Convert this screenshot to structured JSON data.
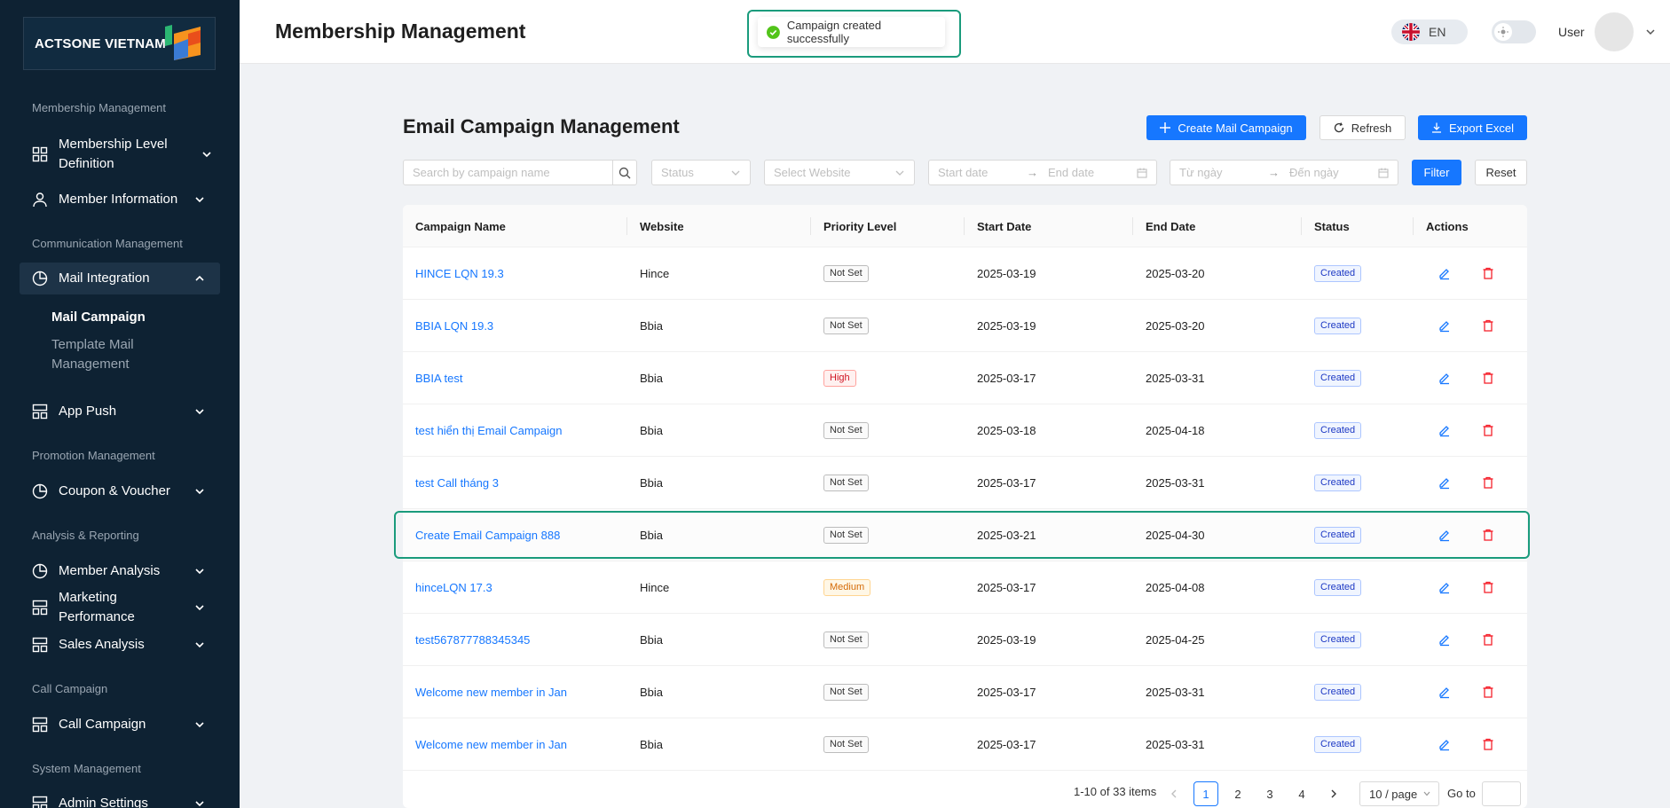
{
  "sidebar": {
    "logo_text": "ACTSONE VIETNAM",
    "sections": {
      "membership": "Membership Management",
      "communication": "Communication Management",
      "promotion": "Promotion Management",
      "analysis": "Analysis & Reporting",
      "call": "Call Campaign",
      "system": "System Management"
    },
    "items": {
      "membership_level": "Membership Level Definition",
      "member_info": "Member Information",
      "mail_integration": "Mail Integration",
      "mail_campaign": "Mail Campaign",
      "template_mail": "Template Mail Management",
      "app_push": "App Push",
      "coupon": "Coupon & Voucher",
      "member_analysis": "Member Analysis",
      "marketing_perf": "Marketing Performance",
      "sales_analysis": "Sales Analysis",
      "call_campaign": "Call Campaign",
      "admin_settings": "Admin Settings"
    }
  },
  "header": {
    "title": "Membership Management",
    "toast": "Campaign created successfully",
    "lang": "EN",
    "user": "User"
  },
  "main": {
    "title": "Email Campaign Management",
    "buttons": {
      "create": "Create Mail Campaign",
      "refresh": "Refresh",
      "export": "Export Excel",
      "filter": "Filter",
      "reset": "Reset"
    },
    "filters": {
      "search_placeholder": "Search by campaign name",
      "status_placeholder": "Status",
      "website_placeholder": "Select Website",
      "start_date": "Start date",
      "end_date": "End date",
      "from_date": "Từ ngày",
      "to_date": "Đến ngày",
      "arrow": "→"
    },
    "table": {
      "columns": [
        "Campaign Name",
        "Website",
        "Priority Level",
        "Start Date",
        "End Date",
        "Status",
        "Actions"
      ],
      "rows": [
        {
          "name": "HINCE LQN 19.3",
          "website": "Hince",
          "priority": "Not Set",
          "start": "2025-03-19",
          "end": "2025-03-20",
          "status": "Created"
        },
        {
          "name": "BBIA LQN 19.3",
          "website": "Bbia",
          "priority": "Not Set",
          "start": "2025-03-19",
          "end": "2025-03-20",
          "status": "Created"
        },
        {
          "name": "BBIA test",
          "website": "Bbia",
          "priority": "High",
          "start": "2025-03-17",
          "end": "2025-03-31",
          "status": "Created"
        },
        {
          "name": "test hiển thị Email Campaign",
          "website": "Bbia",
          "priority": "Not Set",
          "start": "2025-03-18",
          "end": "2025-04-18",
          "status": "Created"
        },
        {
          "name": "test Call tháng 3",
          "website": "Bbia",
          "priority": "Not Set",
          "start": "2025-03-17",
          "end": "2025-03-31",
          "status": "Created"
        },
        {
          "name": "Create Email Campaign 888",
          "website": "Bbia",
          "priority": "Not Set",
          "start": "2025-03-21",
          "end": "2025-04-30",
          "status": "Created"
        },
        {
          "name": "hinceLQN 17.3",
          "website": "Hince",
          "priority": "Medium",
          "start": "2025-03-17",
          "end": "2025-04-08",
          "status": "Created"
        },
        {
          "name": "test567877788345345",
          "website": "Bbia",
          "priority": "Not Set",
          "start": "2025-03-19",
          "end": "2025-04-25",
          "status": "Created"
        },
        {
          "name": "Welcome new member in Jan",
          "website": "Bbia",
          "priority": "Not Set",
          "start": "2025-03-17",
          "end": "2025-03-31",
          "status": "Created"
        },
        {
          "name": "Welcome new member in Jan",
          "website": "Bbia",
          "priority": "Not Set",
          "start": "2025-03-17",
          "end": "2025-03-31",
          "status": "Created"
        }
      ]
    },
    "pagination": {
      "info": "1-10 of 33 items",
      "pages": [
        "1",
        "2",
        "3",
        "4"
      ],
      "current": "1",
      "page_size": "10 / page",
      "goto": "Go to"
    }
  },
  "colors": {
    "sidebar_bg": "#0e2233",
    "primary": "#1677ff",
    "highlight": "#1a9b7c",
    "danger": "#f5222d"
  }
}
